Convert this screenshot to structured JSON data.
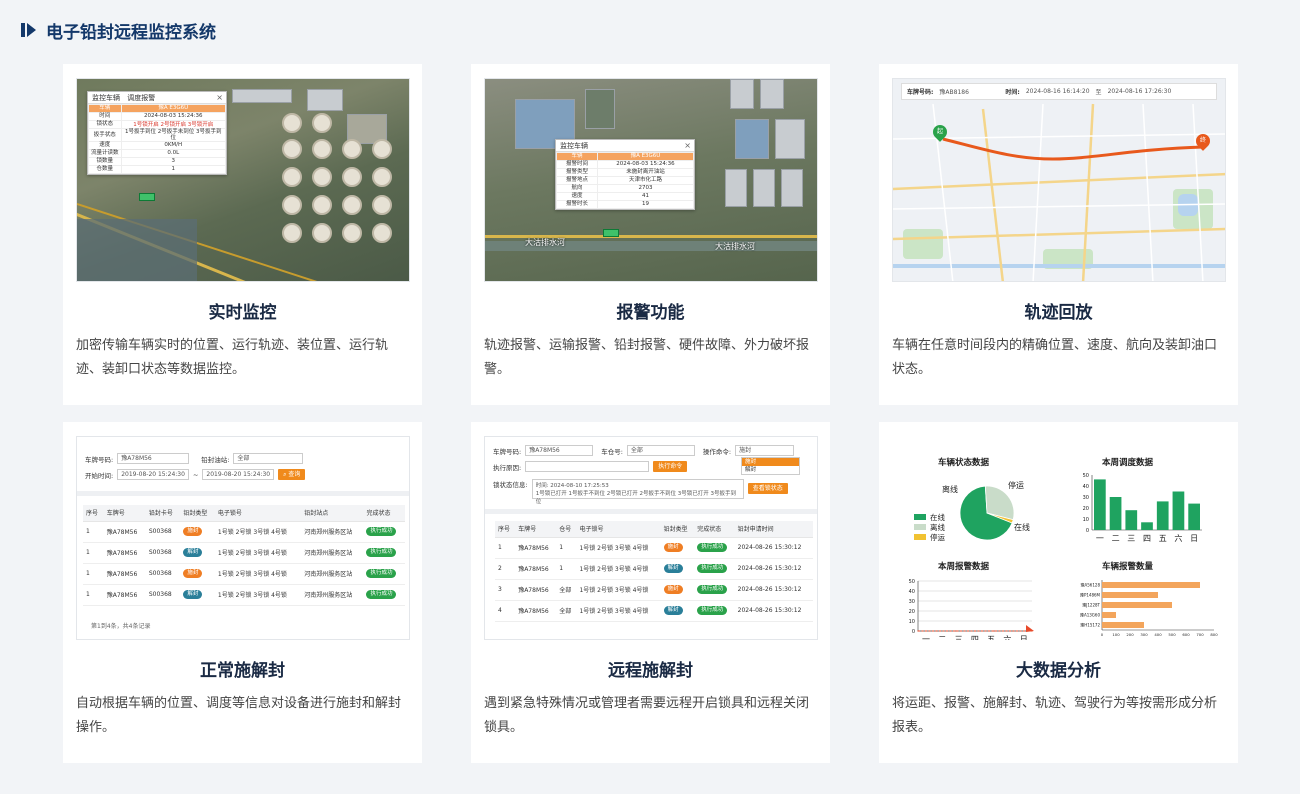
{
  "page": {
    "title": "电子铅封远程监控系统",
    "accent": "#14386a"
  },
  "cards": [
    {
      "title": "实时监控",
      "desc": "加密传输车辆实时的位置、运行轨迹、装位置、运行轨迹、装卸口状态等数据监控。",
      "screen": {
        "popup_title": "监控车辆",
        "popup_tab": "调度报警",
        "rows": [
          {
            "k": "车辆",
            "v": "豫A E3G6U"
          },
          {
            "k": "时间",
            "v": "2024-08-03 15:24:36"
          },
          {
            "k": "锁状态",
            "v": "1号锁开启  2号锁开启  3号锁开启"
          },
          {
            "k": "扳手状态",
            "v": "1号扳手到位  2号扳手未到位  3号扳手到位"
          },
          {
            "k": "速度",
            "v": "0KM/H"
          },
          {
            "k": "流量计读数",
            "v": "0.0L"
          },
          {
            "k": "锁数量",
            "v": "3"
          },
          {
            "k": "仓数量",
            "v": "1"
          }
        ]
      }
    },
    {
      "title": "报警功能",
      "desc": "轨迹报警、运输报警、铅封报警、硬件故障、外力破坏报警。",
      "screen": {
        "popup_title": "监控车辆",
        "rows": [
          {
            "k": "车辆",
            "v": "豫A E3G6U"
          },
          {
            "k": "报警时间",
            "v": "2024-08-03 15:24:36"
          },
          {
            "k": "报警类型",
            "v": "未施封离开油站"
          },
          {
            "k": "报警地点",
            "v": "天津市化工路"
          },
          {
            "k": "航向",
            "v": "2703"
          },
          {
            "k": "速度",
            "v": "41"
          },
          {
            "k": "报警时长",
            "v": "19"
          }
        ],
        "map_label_1": "大沽排水河",
        "map_label_2": "大沽排水河"
      }
    },
    {
      "title": "轨迹回放",
      "desc": "车辆在任意时间段内的精确位置、速度、航向及装卸油口状态。",
      "screen": {
        "plate_label": "车牌号码:",
        "plate_value": "豫AB8186",
        "time_label": "时间:",
        "time_from": "2024-08-16 16:14:20",
        "time_to_sep": "至",
        "time_to": "2024-08-16 17:26:30",
        "start_pin": "起",
        "end_pin": "终",
        "track_color": "#e8591c"
      }
    },
    {
      "title": "正常施解封",
      "desc": "自动根据车辆的位置、调度等信息对设备进行施封和解封操作。",
      "screen": {
        "plate_label": "车牌号码:",
        "plate_value": "豫A78M56",
        "station_label": "铅封油站:",
        "station_value": "全部",
        "start_label": "开始时间:",
        "start_value": "2019-08-20 15:24:30",
        "sep": "~",
        "end_value": "2019-08-20 15:24:30",
        "query_btn": "查询",
        "headers": [
          "序号",
          "车牌号",
          "铅封卡号",
          "铅封类型",
          "电子锁号",
          "铅封站点",
          "完成状态"
        ],
        "rows": [
          [
            "1",
            "豫A78M56",
            "S00368",
            "施封",
            "1号锁 2号锁 3号锁 4号锁",
            "河南郑州服务区站",
            "执行成功"
          ],
          [
            "1",
            "豫A78M56",
            "S00368",
            "解封",
            "1号锁 2号锁 3号锁 4号锁",
            "河南郑州服务区站",
            "执行成功"
          ],
          [
            "1",
            "豫A78M56",
            "S00368",
            "施封",
            "1号锁 2号锁 3号锁 4号锁",
            "河南郑州服务区站",
            "执行成功"
          ],
          [
            "1",
            "豫A78M56",
            "S00368",
            "解封",
            "1号锁 2号锁 3号锁 4号锁",
            "河南郑州服务区站",
            "执行成功"
          ]
        ],
        "footer": "第1到4条，共4条记录"
      }
    },
    {
      "title": "远程施解封",
      "desc": "遇到紧急特殊情况或管理者需要远程开启锁具和远程关闭锁具。",
      "screen": {
        "plate_label": "车牌号码:",
        "plate_value": "豫A78M56",
        "bin_label": "车仓号:",
        "bin_value": "全部",
        "cmd_label": "操作命令:",
        "cmd_value": "施封",
        "cmd_options": [
          "施封",
          "解封"
        ],
        "reason_label": "执行原因:",
        "exec_btn": "执行命令",
        "lock_label": "锁状态信息:",
        "lock_time": "时间: 2024-08-10 17:25:53",
        "lock_detail": "1号锁已打开 1号扳手不到位 2号锁已打开 2号扳手不到位 3号锁已打开 3号扳手到位",
        "lock_btn": "查看锁状态",
        "headers": [
          "序号",
          "车牌号",
          "仓号",
          "电子锁号",
          "铅封类型",
          "完成状态",
          "铅封申请时间"
        ],
        "rows": [
          [
            "1",
            "豫A78M56",
            "1",
            "1号锁 2号锁 3号锁 4号锁",
            "施封",
            "执行成功",
            "2024-08-26 15:30:12"
          ],
          [
            "2",
            "豫A78M56",
            "1",
            "1号锁 2号锁 3号锁 4号锁",
            "解封",
            "执行成功",
            "2024-08-26 15:30:12"
          ],
          [
            "3",
            "豫A78M56",
            "全部",
            "1号锁 2号锁 3号锁 4号锁",
            "施封",
            "执行成功",
            "2024-08-26 15:30:12"
          ],
          [
            "4",
            "豫A78M56",
            "全部",
            "1号锁 2号锁 3号锁 4号锁",
            "解封",
            "执行成功",
            "2024-08-26 15:30:12"
          ]
        ]
      }
    },
    {
      "title": "大数据分析",
      "desc": "将运距、报警、施解封、轨迹、驾驶行为等按需形成分析报表。"
    }
  ],
  "chart_data": [
    {
      "type": "pie",
      "title": "车辆状态数据",
      "labels": [
        "在线",
        "离线",
        "停运"
      ],
      "values": [
        68,
        30,
        2
      ],
      "colors": [
        "#1fa360",
        "#c9dcc9",
        "#f1c232"
      ],
      "legend": "bottom-left"
    },
    {
      "type": "bar",
      "title": "本周调度数据",
      "categories": [
        "一",
        "二",
        "三",
        "四",
        "五",
        "六",
        "日"
      ],
      "values": [
        46,
        30,
        18,
        7,
        26,
        35,
        24
      ],
      "ylim": [
        0,
        50
      ],
      "yticks": [
        0,
        10,
        20,
        30,
        40,
        50
      ],
      "color": "#1fa360"
    },
    {
      "type": "line",
      "title": "本周报警数据",
      "categories": [
        "一",
        "二",
        "三",
        "四",
        "五",
        "六",
        "日"
      ],
      "values": [
        0,
        0,
        0,
        0,
        0,
        0,
        0
      ],
      "ylim": [
        0,
        50
      ],
      "yticks": [
        0,
        10,
        20,
        30,
        40,
        50
      ],
      "color": "#e84a2a"
    },
    {
      "type": "bar",
      "orientation": "horizontal",
      "title": "车辆报警数量",
      "categories": [
        "豫A56128",
        "豫P1486M",
        "豫J1228T",
        "豫A13G60",
        "豫H15172"
      ],
      "values": [
        700,
        400,
        500,
        100,
        300
      ],
      "xlim": [
        0,
        800
      ],
      "xticks": [
        0,
        100,
        200,
        300,
        400,
        500,
        600,
        700,
        800
      ],
      "color": "#f3a55c"
    }
  ]
}
